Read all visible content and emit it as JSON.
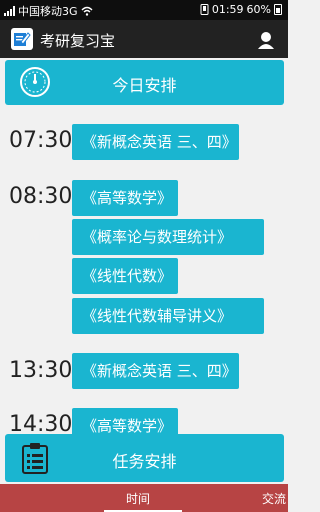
{
  "status_bar": {
    "carrier": "中国移动3G",
    "time": "01:59",
    "battery": "60%"
  },
  "app_bar": {
    "title": "考研复习宝"
  },
  "today_button": {
    "label": "今日安排"
  },
  "schedule": [
    {
      "time": "07:30",
      "items": [
        "《新概念英语 三、四》"
      ]
    },
    {
      "time": "08:30",
      "items": [
        "《高等数学》",
        "《概率论与数理统计》",
        "《线性代数》",
        "《线性代数辅导讲义》"
      ]
    },
    {
      "time": "13:30",
      "items": [
        "《新概念英语 三、四》"
      ]
    },
    {
      "time": "14:30",
      "items": [
        "《高等数学》"
      ]
    }
  ],
  "task_button": {
    "label": "任务安排"
  },
  "tabs": {
    "time": "时间",
    "chat": "交流"
  },
  "colors": {
    "accent": "#1ab5d0",
    "tabbar": "#b74444",
    "appbar": "#222222"
  },
  "icons": [
    "wifi-icon",
    "signal-icon",
    "battery-icon",
    "edit-icon",
    "user-icon",
    "gauge-icon",
    "clipboard-icon"
  ]
}
